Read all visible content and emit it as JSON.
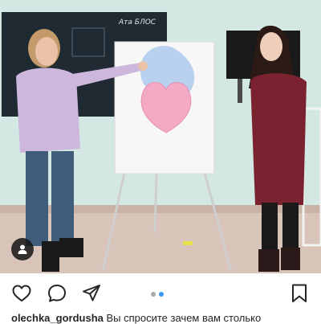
{
  "post": {
    "photo_board_text": "Ата БЛОС",
    "photo_description_icon": "photo"
  },
  "actions": {
    "like_icon": "heart-outline-icon",
    "comment_icon": "speech-bubble-icon",
    "share_icon": "paper-plane-icon",
    "save_icon": "bookmark-outline-icon"
  },
  "carousel": {
    "total": 2,
    "active_index": 1,
    "active_color": "#3897f0",
    "inactive_color": "#a8a8a8"
  },
  "caption": {
    "username": "olechka_gordusha",
    "text": " Вы спросите зачем вам столько"
  },
  "colors": {
    "heart_sticker": "#f4a9c4",
    "cloud_sticker": "#b9d1ee"
  }
}
